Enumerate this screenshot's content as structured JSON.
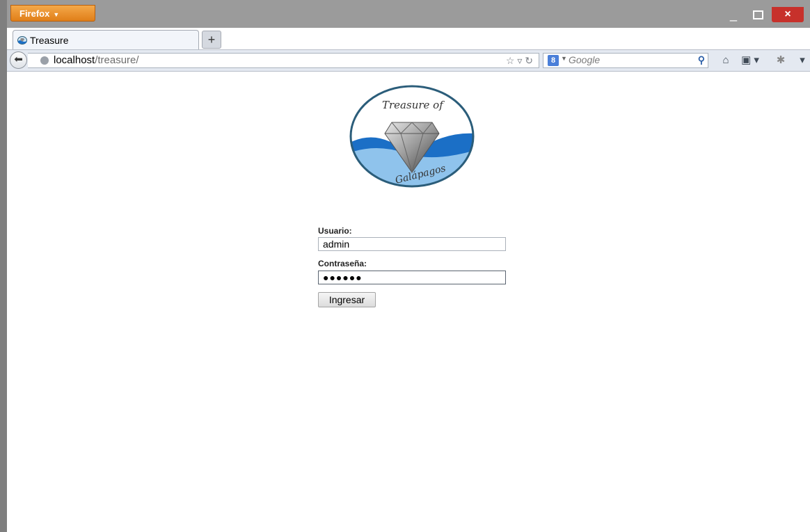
{
  "browser": {
    "menu_label": "Firefox",
    "window_controls": {
      "minimize": "_",
      "close": "×"
    },
    "tab": {
      "title": "Treasure",
      "favicon": "treasure-favicon-icon"
    },
    "new_tab_label": "+",
    "url": {
      "host": "localhost",
      "path": "/treasure/"
    },
    "search": {
      "engine_badge": "8",
      "placeholder": "Google"
    },
    "icons": {
      "back": "back-arrow-icon",
      "site": "globe-icon",
      "bookmark_star": "star-icon",
      "reload": "reload-icon",
      "search": "magnifier-icon",
      "home": "home-icon",
      "bookmarks": "bookmarks-icon",
      "addon": "addon-icon",
      "menu": "menu-arrow-icon"
    }
  },
  "page": {
    "logo": {
      "top_text": "Treasure of",
      "bottom_text": "Galápagos"
    },
    "form": {
      "username_label": "Usuario:",
      "username_value": "admin",
      "password_label": "Contraseña:",
      "password_mask": "●●●●●●",
      "submit_label": "Ingresar"
    }
  },
  "colors": {
    "firefox_orange": "#e8891f",
    "close_red": "#c7312b",
    "chrome_gray": "#9b9b9b",
    "wave_blue": "#1b6fc6",
    "logo_ring": "#2b5d7a"
  }
}
